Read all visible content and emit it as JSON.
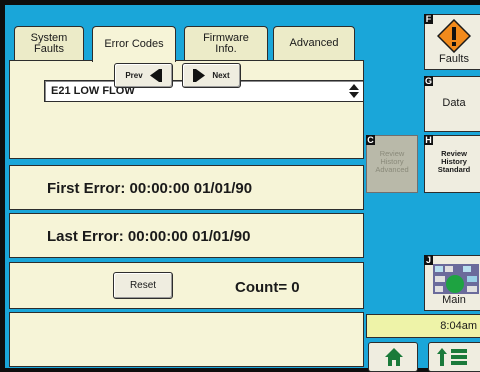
{
  "tabs": [
    {
      "label": "System\nFaults"
    },
    {
      "label": "Error Codes"
    },
    {
      "label": "Firmware\nInfo."
    },
    {
      "label": "Advanced"
    }
  ],
  "error_select": {
    "value": "E21 LOW FLOW"
  },
  "prev_label": "Prev",
  "next_label": "Next",
  "first_error": "First Error: 00:00:00  01/01/90",
  "last_error": "Last Error: 00:00:00  01/01/90",
  "reset_label": "Reset",
  "count_text": "Count= 0",
  "side": {
    "faults": {
      "letter": "F",
      "label": "Faults"
    },
    "data": {
      "letter": "G",
      "label": "Data"
    },
    "review_adv": {
      "letter": "C",
      "label": "Review\nHistory\nAdvanced"
    },
    "review_std": {
      "letter": "H",
      "label": "Review\nHistory\nStandard"
    },
    "main": {
      "letter": "J",
      "label": "Main"
    }
  },
  "time": "8:04am",
  "colors": {
    "screen": "#1aa6d9",
    "panel": "#f6f4d7",
    "time_bg": "#eef3a8",
    "warning": "#f18a1c"
  }
}
